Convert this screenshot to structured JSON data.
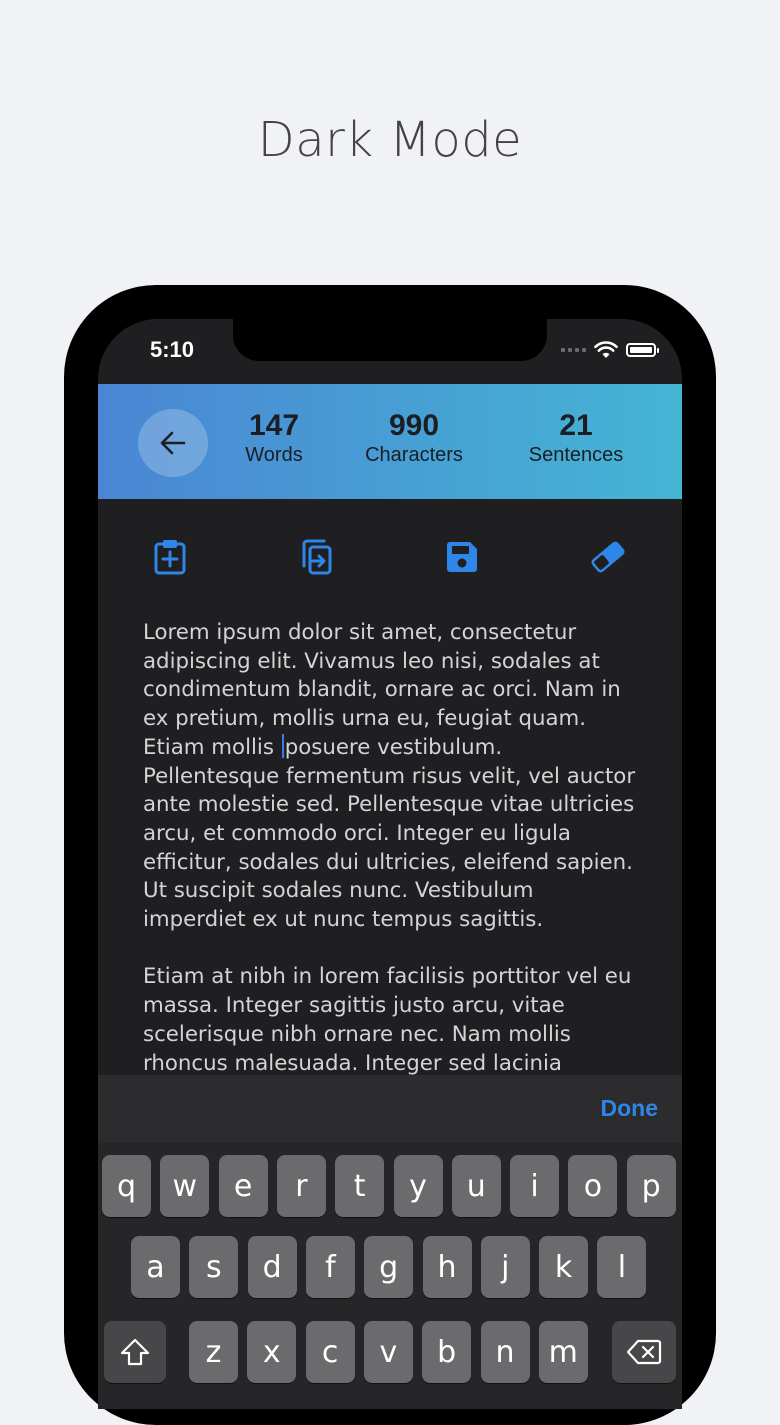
{
  "headline": "Dark Mode",
  "status_bar": {
    "time": "5:10"
  },
  "stats": {
    "words": {
      "value": "147",
      "label": "Words"
    },
    "characters": {
      "value": "990",
      "label": "Characters"
    },
    "sentences": {
      "value": "21",
      "label": "Sentences"
    }
  },
  "toolbar": {
    "icons": [
      "clipboard-paste-icon",
      "copy-icon",
      "save-icon",
      "eraser-icon"
    ],
    "accent_color": "#2e86e6"
  },
  "editor": {
    "text_before_cursor": "Lorem ipsum dolor sit amet, consectetur\nadipiscing elit. Vivamus leo nisi, sodales at\ncondimentum blandit, ornare ac orci. Nam in\nex pretium, mollis urna eu, feugiat quam.\nEtiam mollis ",
    "text_after_cursor": "posuere vestibulum.\nPellentesque fermentum risus velit, vel auctor\nante molestie sed. Pellentesque vitae ultricies\narcu, et commodo orci. Integer eu ligula\nefficitur, sodales dui ultricies, eleifend sapien.\nUt suscipit sodales nunc. Vestibulum\nimperdiet ex ut nunc tempus sagittis.\n\nEtiam at nibh in lorem facilisis porttitor vel eu\nmassa. Integer sagittis justo arcu, vitae\nscelerisque nibh ornare nec. Nam mollis\nrhoncus malesuada. Integer sed lacinia"
  },
  "keyboard": {
    "done_label": "Done",
    "row1": [
      "q",
      "w",
      "e",
      "r",
      "t",
      "y",
      "u",
      "i",
      "o",
      "p"
    ],
    "row2": [
      "a",
      "s",
      "d",
      "f",
      "g",
      "h",
      "j",
      "k",
      "l"
    ],
    "row3": [
      "z",
      "x",
      "c",
      "v",
      "b",
      "n",
      "m"
    ]
  }
}
